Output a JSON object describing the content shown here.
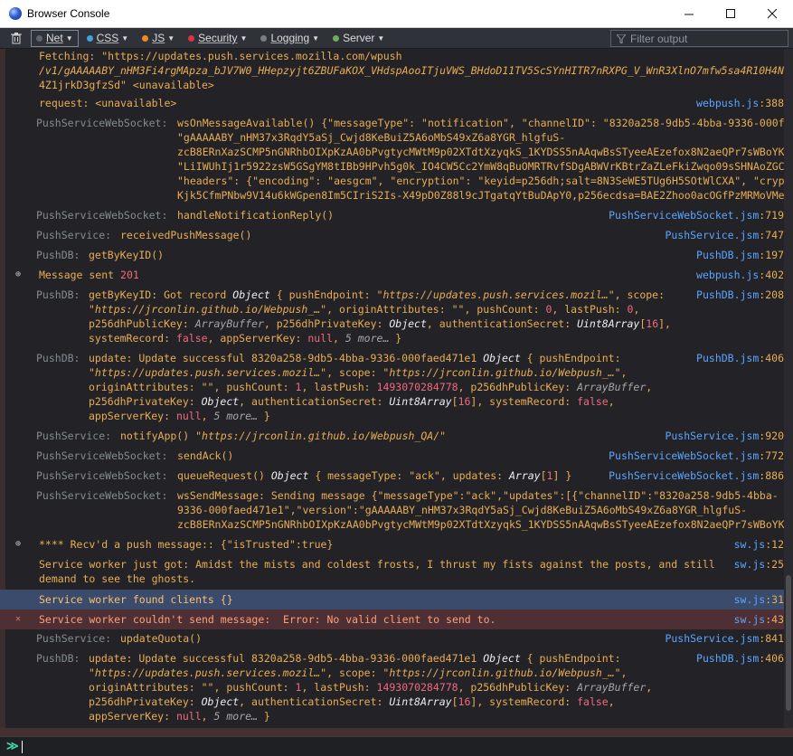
{
  "window": {
    "title": "Browser Console",
    "minimize": "—",
    "maximize": "☐",
    "close": "✕"
  },
  "toolbar": {
    "filters": [
      {
        "label": "Net",
        "color": "#5b6670"
      },
      {
        "label": "CSS",
        "color": "#43a1dd"
      },
      {
        "label": "JS",
        "color": "#f08c1c"
      },
      {
        "label": "Security",
        "color": "#e0323f"
      },
      {
        "label": "Logging",
        "color": "#7a7f86"
      },
      {
        "label": "Server",
        "color": "#6bae5b"
      }
    ],
    "filter_placeholder": "Filter output",
    "caret": "▼"
  },
  "console": {
    "fetch": {
      "l1": "Fetching: \"https://updates.push.services.mozilla.com/wpush",
      "l2": "/v1/gAAAAABY_nHM3Fi4rgMApza_bJV7W0_HHepzyjt6ZBUFaKOX_VHdspAooITjuVWS_BHdoD11TV5ScSYnHITR7nRXPG_V_WnR3XlnO7mfw5sa4R10H4N",
      "l3": "4Z1jrkD3gfzSd\" <unavailable>"
    },
    "request": {
      "text": "request: <unavailable>",
      "file": "webpush.js",
      "line": ":388"
    },
    "ws_available": {
      "cat": "PushServiceWebSocket:",
      "l1": "wsOnMessageAvailable() {\"messageType\": \"notification\", \"channelID\": \"8320a258-9db5-4bba-9336-000f",
      "l2": "\"gAAAAABY_nHM37x3RqdY5aSj_Cwjd8KeBuiZ5A6oMbS49xZ6a8YGR_hlgfuS-",
      "l3": "zcB8ERnXazSCMP5nGNRhbOIXpKzAA0bPvgtycMWtM9p02XTdtXzyqkS_1KYDSS5nAAqwBsSTyeeAEzefox8N2aeQPr7sWBoYK",
      "l4": "\"LiIWUhIj1r5922zsW5GSgYM8tIBb9HPvh5g0k_IO4CW5Cc2YmW8qBuOMRTRvfSDgABWVrKBtrZaZLeFkiZwqo09sSHNAoZGC",
      "l5": "\"headers\": {\"encoding\": \"aesgcm\", \"encryption\": \"keyid=p256dh;salt=8N3SeWE5TUg6H5SOtWlCXA\", \"cryp",
      "l6": "Kjk5CfmPNbw9V14u6kWGpen8Im5CIriS2Is-X49pD0Z88l9cJTgatqYtBuDApY0,p256ecdsa=BAE2Zhoo0acOGfPzMRMoVMe"
    },
    "handle_reply": {
      "cat": "PushServiceWebSocket:",
      "text": "handleNotificationReply()",
      "file": "PushServiceWebSocket.jsm",
      "line": ":719"
    },
    "received": {
      "cat": "PushService:",
      "text": "receivedPushMessage()",
      "file": "PushService.jsm",
      "line": ":747"
    },
    "getbykey": {
      "cat": "PushDB:",
      "text": "getByKeyID()",
      "file": "PushDB.jsm",
      "line": ":197"
    },
    "sent": {
      "text": "Message sent",
      "num": "201",
      "file": "webpush.js",
      "line": ":402"
    },
    "got_record": {
      "cat": "PushDB:",
      "file": "PushDB.jsm",
      "line": ":208",
      "a": "getByKeyID: Got record",
      "obj": "Object",
      "b": "{ pushEndpoint: ",
      "s1": "\"https://updates.push.services.mozil…\"",
      "c": ", scope:",
      "s2": "\"https://jrconlin.github.io/Webpush_…\"",
      "d": ", originAttributes: ",
      "e": "\"\"",
      "f": ", pushCount: ",
      "n1": "0",
      "g": ", lastPush: ",
      "n2": "0",
      "h": ",",
      "i": "p256dhPublicKey: ",
      "t1": "ArrayBuffer",
      "j": ", p256dhPrivateKey: ",
      "t2": "Object",
      "k": ", authenticationSecret: ",
      "t3": "Uint8Array",
      "m": "[",
      "n3": "16",
      "p": "],",
      "q": "systemRecord: ",
      "b1": "false",
      "r": ", appServerKey: ",
      "b2": "null",
      "more": "5 more…",
      "z": " }"
    },
    "update1": {
      "cat": "PushDB:",
      "file": "PushDB.jsm",
      "line": ":406",
      "a": "update: Update successful 8320a258-9db5-4bba-9336-000faed471e1",
      "obj": "Object",
      "b": " { pushEndpoint:",
      "s1": "\"https://updates.push.services.mozil…\"",
      "c": ", scope: ",
      "s2": "\"https://jrconlin.github.io/Webpush_…\"",
      "c2": ",",
      "d": "originAttributes: ",
      "e": "\"\"",
      "f": ", pushCount: ",
      "n1": "1",
      "g": ", lastPush: ",
      "n2": "1493070284778",
      "g2": ", p256dhPublicKey: ",
      "t1": "ArrayBuffer",
      "g3": ",",
      "i": "p256dhPrivateKey: ",
      "t2": "Object",
      "k": ", authenticationSecret: ",
      "t3": "Uint8Array",
      "m": "[",
      "n3": "16",
      "p": "], systemRecord: ",
      "b1": "false",
      "p2": ",",
      "q": "appServerKey: ",
      "b2": "null",
      "more": "5 more…",
      "z": " }"
    },
    "notify": {
      "cat": "PushService:",
      "a": "notifyApp() ",
      "s": "\"https://jrconlin.github.io/Webpush_QA/\"",
      "file": "PushService.jsm",
      "line": ":920"
    },
    "sendack": {
      "cat": "PushServiceWebSocket:",
      "text": "sendAck()",
      "file": "PushServiceWebSocket.jsm",
      "line": ":772"
    },
    "queue": {
      "cat": "PushServiceWebSocket:",
      "a": "queueRequest() ",
      "obj": "Object",
      "b": " { messageType: ",
      "s": "\"ack\"",
      "c": ", updates: ",
      "t": "Array",
      "d": "[",
      "n": "1",
      "e": "] }",
      "file": "PushServiceWebSocket.jsm",
      "line": ":886"
    },
    "ws_send": {
      "cat": "PushServiceWebSocket:",
      "l1": "wsSendMessage: Sending message {\"messageType\":\"ack\",\"updates\":[{\"channelID\":\"8320a258-9db5-4bba-",
      "l2": "9336-000faed471e1\",\"version\":\"gAAAAABY_nHM37x3RqdY5aSj_Cwjd8KeBuiZ5A6oMbS49xZ6a8YGR_hlgfuS-",
      "l3": "zcB8ERnXazSCMP5nGNRhbOIXpKzAA0bPvgtycMWtM9p02XTdtXzyqkS_1KYDSS5nAAqwBsSTyeeAEzefox8N2aeQPr7sWBoYK"
    },
    "recvd": {
      "text": "**** Recv'd a push message:: {\"isTrusted\":true}",
      "file": "sw.js",
      "line": ":12"
    },
    "sw_got": {
      "l1": "Service worker just got: Amidst the mists and coldest frosts, I thrust my fists against the posts, and still",
      "l2": "demand to see the ghosts.",
      "file": "sw.js",
      "line": ":25"
    },
    "sw_found": {
      "text": "Service worker found clients {}",
      "file": "sw.js",
      "line": ":31"
    },
    "sw_err": {
      "text": "Service worker couldn't send message:  Error: No valid client to send to.",
      "file": "sw.js",
      "line": ":43"
    },
    "quota": {
      "cat": "PushService:",
      "text": "updateQuota()",
      "file": "PushService.jsm",
      "line": ":841"
    },
    "update2": {
      "cat": "PushDB:",
      "file": "PushDB.jsm",
      "line": ":406",
      "a": "update: Update successful 8320a258-9db5-4bba-9336-000faed471e1",
      "obj": "Object",
      "b": " { pushEndpoint:",
      "s1": "\"https://updates.push.services.mozil…\"",
      "c": ", scope: ",
      "s2": "\"https://jrconlin.github.io/Webpush_…\"",
      "c2": ",",
      "d": "originAttributes: ",
      "e": "\"\"",
      "f": ", pushCount: ",
      "n1": "1",
      "g": ", lastPush: ",
      "n2": "1493070284778",
      "g2": ", p256dhPublicKey: ",
      "t1": "ArrayBuffer",
      "g3": ",",
      "i": "p256dhPrivateKey: ",
      "t2": "Object",
      "k": ", authenticationSecret: ",
      "t3": "Uint8Array",
      "m": "[",
      "n3": "16",
      "p": "], systemRecord: ",
      "b1": "false",
      "p2": ",",
      "q": "appServerKey: ",
      "b2": "null",
      "more": "5 more…",
      "z": " }"
    }
  },
  "input": {
    "prompt": "≫"
  }
}
